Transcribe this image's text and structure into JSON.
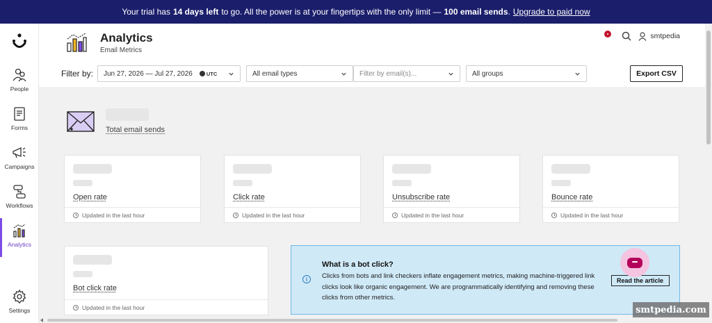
{
  "banner": {
    "text1": "Your trial has",
    "days": "14 days left",
    "text2": "to go. All the power is at your fingertips with the only limit —",
    "limit": "100 email sends",
    "text3": ".",
    "link": "Upgrade to paid now"
  },
  "sidebar": {
    "items": [
      {
        "label": "People"
      },
      {
        "label": "Forms"
      },
      {
        "label": "Campaigns"
      },
      {
        "label": "Workflows"
      },
      {
        "label": "Analytics"
      },
      {
        "label": "Settings"
      }
    ],
    "active_color": "#7c4de6"
  },
  "header": {
    "title": "Analytics",
    "subtitle": "Email Metrics",
    "username": "smtpedia"
  },
  "filters": {
    "label": "Filter by:",
    "date_range": "Jun 27, 2026 — Jul 27, 2026",
    "timezone": "UTC",
    "email_type": "All email types",
    "email_filter_placeholder": "Filter by email(s)...",
    "groups": "All groups",
    "export_label": "Export CSV"
  },
  "summary": {
    "total_label": "Total email sends"
  },
  "metrics": [
    {
      "name": "Open rate",
      "updated": "Updated in the last hour"
    },
    {
      "name": "Click rate",
      "updated": "Updated in the last hour"
    },
    {
      "name": "Unsubscribe rate",
      "updated": "Updated in the last hour"
    },
    {
      "name": "Bounce rate",
      "updated": "Updated in the last hour"
    },
    {
      "name": "Bot click rate",
      "updated": "Updated in the last hour"
    }
  ],
  "bot_info": {
    "title": "What is a bot click?",
    "body": "Clicks from bots and link checkers inflate engagement metrics, making machine-triggered link clicks look like organic engagement. We are programmatically identifying and removing these clicks from other metrics.",
    "button": "Read the article"
  },
  "watermark": "smtpedia.com",
  "colors": {
    "banner_bg": "#1b1e6b",
    "info_bg": "#cfe9f7",
    "info_border": "#6fb9e6",
    "chat_bg": "#f4c4e0",
    "chat_icon": "#b4005a"
  }
}
